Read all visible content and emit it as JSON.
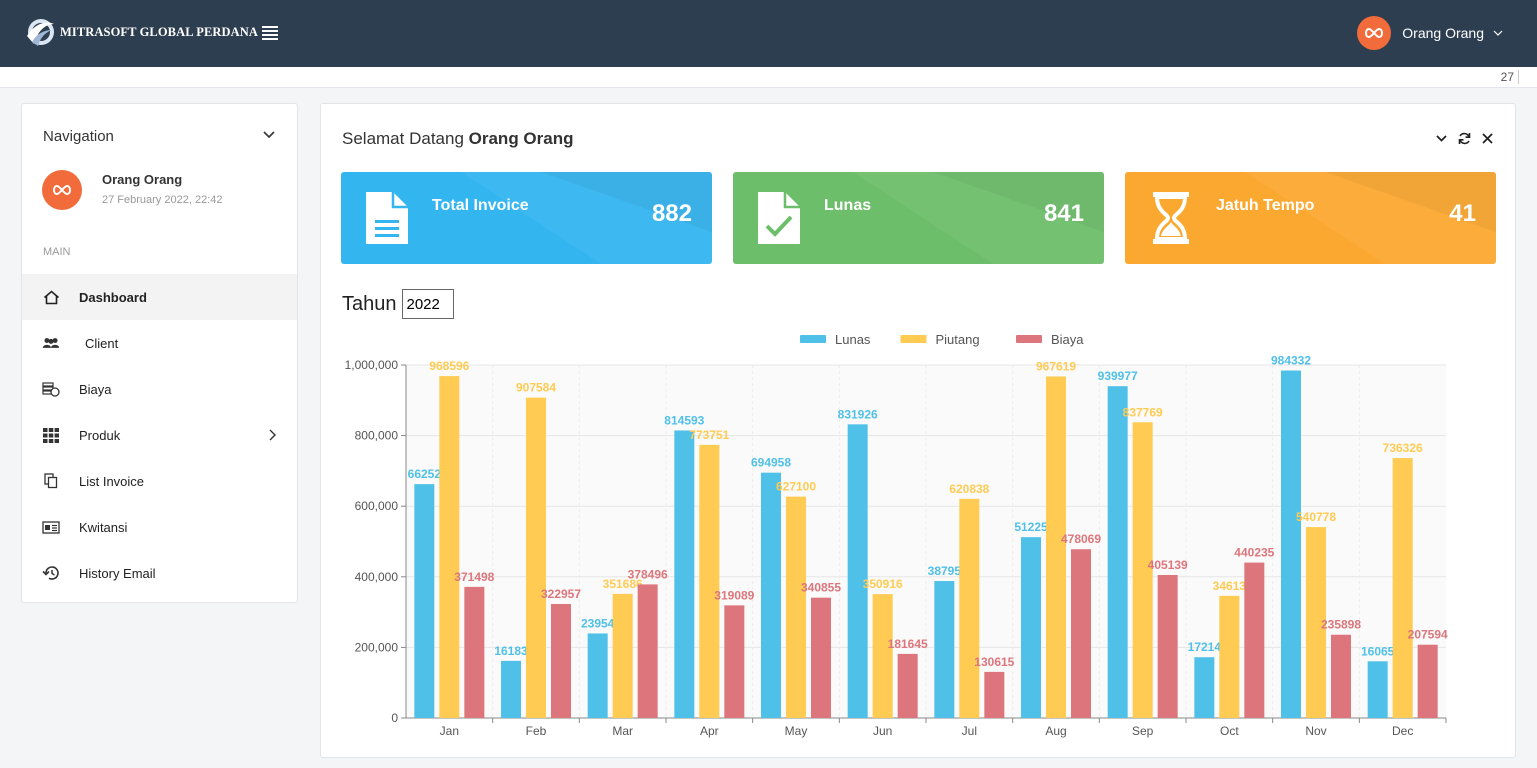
{
  "header": {
    "brand_name": "MITRASOFT GLOBAL PERDANA",
    "user_name": "Orang Orang",
    "subbar_number": "27"
  },
  "sidebar": {
    "title": "Navigation",
    "user_name": "Orang Orang",
    "user_date": "27 February 2022, 22:42",
    "section_label": "MAIN",
    "items": [
      {
        "label": "Dashboard",
        "icon": "home-icon",
        "active": true
      },
      {
        "label": "Client",
        "icon": "users-icon"
      },
      {
        "label": "Biaya",
        "icon": "money-icon"
      },
      {
        "label": "Produk",
        "icon": "grid-icon",
        "has_submenu": true
      },
      {
        "label": "List Invoice",
        "icon": "copy-icon"
      },
      {
        "label": "Kwitansi",
        "icon": "receipt-icon"
      },
      {
        "label": "History Email",
        "icon": "history-icon"
      }
    ]
  },
  "main": {
    "welcome_prefix": "Selamat Datang",
    "welcome_name": "Orang Orang",
    "stats": [
      {
        "label": "Total Invoice",
        "value": "882",
        "color": "#33b5f0",
        "icon": "document-icon"
      },
      {
        "label": "Lunas",
        "value": "841",
        "color": "#6cbe6a",
        "icon": "document-check-icon"
      },
      {
        "label": "Jatuh Tempo",
        "value": "41",
        "color": "#fba830",
        "icon": "hourglass-icon"
      }
    ],
    "year_label": "Tahun",
    "year_value": "2022"
  },
  "chart_data": {
    "type": "bar",
    "categories": [
      "Jan",
      "Feb",
      "Mar",
      "Apr",
      "May",
      "Jun",
      "Jul",
      "Aug",
      "Sep",
      "Oct",
      "Nov",
      "Dec"
    ],
    "series": [
      {
        "name": "Lunas",
        "color": "#4fc0e8",
        "values": [
          662520,
          161830,
          239540,
          814593,
          694958,
          831926,
          387950,
          512250,
          939977,
          172140,
          984332,
          160650
        ],
        "labels": [
          "66252",
          "16183",
          "23954",
          "814593",
          "694958",
          "831926",
          "38795",
          "51225",
          "939977",
          "17214",
          "984332",
          "16065"
        ]
      },
      {
        "name": "Piutang",
        "color": "#ffcb52",
        "values": [
          968596,
          907584,
          351686,
          773751,
          627100,
          350916,
          620838,
          967619,
          837769,
          346130,
          540778,
          736326
        ],
        "labels": [
          "968596",
          "907584",
          "351686",
          "773751",
          "627100",
          "350916",
          "620838",
          "967619",
          "837769",
          "34613",
          "540778",
          "736326"
        ]
      },
      {
        "name": "Biaya",
        "color": "#dd767c",
        "values": [
          371498,
          322957,
          378496,
          319089,
          340855,
          181645,
          130615,
          478069,
          405139,
          440235,
          235898,
          207594
        ],
        "labels": [
          "371498",
          "322957",
          "378496",
          "319089",
          "340855",
          "181645",
          "130615",
          "478069",
          "405139",
          "440235",
          "235898",
          "207594"
        ]
      }
    ],
    "ylim": [
      0,
      1000000
    ],
    "yticks": [
      0,
      200000,
      400000,
      600000,
      800000,
      1000000
    ],
    "ytick_labels": [
      "0",
      "200,000",
      "400,000",
      "600,000",
      "800,000",
      "1,000,000"
    ],
    "legend_position": "top-center",
    "grid": true
  }
}
